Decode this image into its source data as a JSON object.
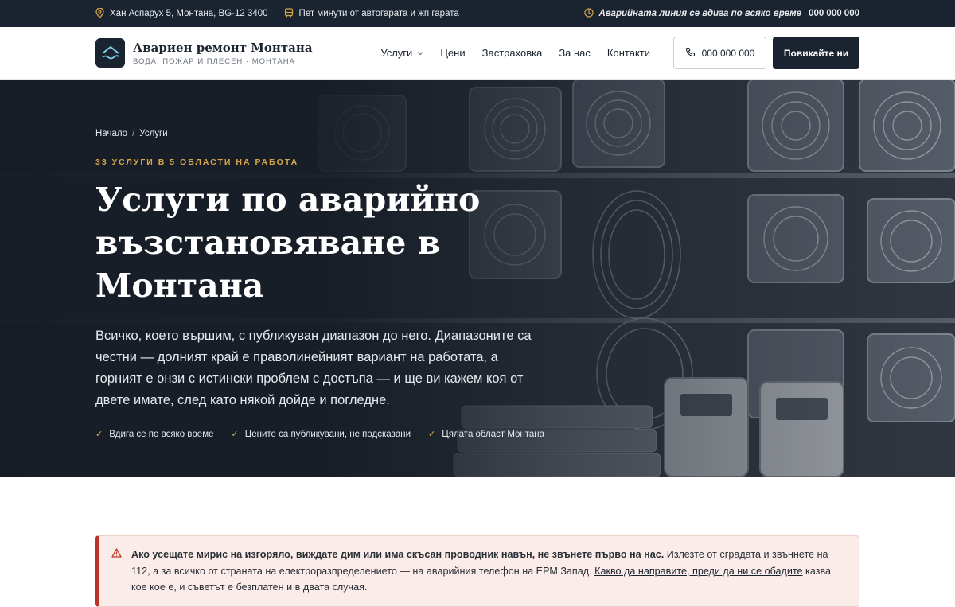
{
  "topbar": {
    "address": "Хан Аспарух 5, Монтана, BG-12 3400",
    "location_note": "Пет минути от автогарата и жп гарата",
    "hotline_label": "Аварийната линия се вдига по всяко време",
    "hotline_number": "000 000 000",
    "icons": [
      "pin-icon",
      "bus-icon",
      "clock-icon"
    ]
  },
  "header": {
    "brand_name": "Авариен ремонт Монтана",
    "brand_tagline": "ВОДА, ПОЖАР И ПЛЕСЕН · МОНТАНА",
    "nav": [
      "Услуги",
      "Цени",
      "Застраховка",
      "За нас",
      "Контакти"
    ],
    "phone": "000 000 000",
    "cta": "Повикайте ни"
  },
  "hero": {
    "breadcrumb": [
      "Начало",
      "Услуги"
    ],
    "breadcrumb_sep": "/",
    "eyebrow": "33 УСЛУГИ В 5 ОБЛАСТИ НА РАБОТА",
    "title": "Услуги по аварийно възстановяване в Монтана",
    "lead": "Всичко, което вършим, с публикуван диапазон до него. Диапазоните са честни — долният край е праволинейният вариант на работата, а горният е онзи с истински проблем с достъпа — и ще ви кажем коя от двете имате, след като някой дойде и погледне.",
    "checks": [
      "Вдига се по всяко време",
      "Цените са публикувани, не подсказани",
      "Цялата област Монтана"
    ]
  },
  "alert": {
    "bold": "Ако усещате мирис на изгоряло, виждате дим или има скъсан проводник навън, не звънете първо на нас.",
    "text1": " Излезте от сградата и звъннете на 112, а за всичко от страната на електроразпределението — на аварийния телефон на ЕРМ Запад. ",
    "link": "Какво да направите, преди да ни се обадите",
    "text2": " казва кое кое е, и съветът е безплатен и в двата случая."
  },
  "colors": {
    "dark": "#1a2330",
    "accent": "#d8a64a",
    "alert_bg": "#fbecea",
    "alert_border": "#b9322b"
  }
}
